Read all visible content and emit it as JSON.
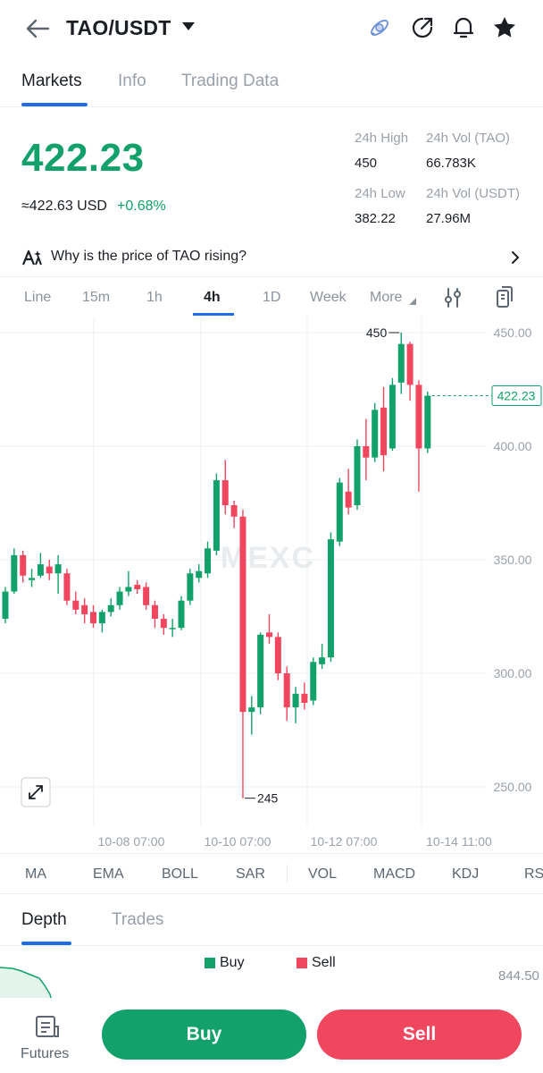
{
  "header": {
    "pair": "TAO/USDT",
    "icons": [
      "back-arrow-icon",
      "dropdown-caret-icon",
      "satellite-icon",
      "share-icon",
      "bell-icon",
      "star-icon"
    ]
  },
  "tabs": [
    {
      "label": "Markets",
      "active": true
    },
    {
      "label": "Info",
      "active": false
    },
    {
      "label": "Trading Data",
      "active": false
    }
  ],
  "ticker": {
    "price": "422.23",
    "usd_approx": "≈422.63  USD",
    "change": "+0.68%",
    "stats": {
      "high_label": "24h High",
      "high_value": "450",
      "vol_tao_label": "24h Vol (TAO)",
      "vol_tao_value": "66.783K",
      "low_label": "24h Low",
      "low_value": "382.22",
      "vol_usdt_label": "24h Vol  (USDT)",
      "vol_usdt_value": "27.96M"
    }
  },
  "why": {
    "text": "Why is the price of TAO rising?"
  },
  "intervals": [
    {
      "label": "Line",
      "active": false
    },
    {
      "label": "15m",
      "active": false
    },
    {
      "label": "1h",
      "active": false
    },
    {
      "label": "4h",
      "active": true
    },
    {
      "label": "1D",
      "active": false
    },
    {
      "label": "Week",
      "active": false
    },
    {
      "label": "More",
      "active": false
    }
  ],
  "chart_data": {
    "type": "candlestick",
    "interval": "4h",
    "watermark": "MEXC",
    "y_axis": {
      "min": 245,
      "max": 450,
      "ticks": [
        450.0,
        400.0,
        350.0,
        300.0,
        250.0
      ],
      "tick_labels": [
        "450.00",
        "400.00",
        "350.00",
        "300.00",
        "250.00"
      ]
    },
    "x_axis": {
      "tick_labels": [
        "10-08 07:00",
        "10-10 07:00",
        "10-12 07:00",
        "10-14 11:00"
      ]
    },
    "current_price_label": "422.23",
    "high_marker": {
      "value": 450,
      "label": "450"
    },
    "low_marker": {
      "value": 245,
      "label": "245"
    },
    "colors": {
      "up": "#12a16a",
      "down": "#f0465e",
      "grid": "#eef0f2"
    },
    "candles": [
      {
        "o": 324,
        "c": 336,
        "h": 338,
        "l": 322
      },
      {
        "o": 336,
        "c": 352,
        "h": 355,
        "l": 335
      },
      {
        "o": 352,
        "c": 343,
        "h": 354,
        "l": 340
      },
      {
        "o": 341,
        "c": 342,
        "h": 346,
        "l": 338
      },
      {
        "o": 343,
        "c": 348,
        "h": 353,
        "l": 342
      },
      {
        "o": 347,
        "c": 344,
        "h": 350,
        "l": 341
      },
      {
        "o": 344,
        "c": 348,
        "h": 352,
        "l": 335
      },
      {
        "o": 344,
        "c": 332,
        "h": 346,
        "l": 330
      },
      {
        "o": 332,
        "c": 328,
        "h": 336,
        "l": 326
      },
      {
        "o": 330,
        "c": 326,
        "h": 333,
        "l": 322
      },
      {
        "o": 327,
        "c": 322,
        "h": 330,
        "l": 320
      },
      {
        "o": 322,
        "c": 327,
        "h": 328,
        "l": 318
      },
      {
        "o": 327,
        "c": 330,
        "h": 333,
        "l": 325
      },
      {
        "o": 330,
        "c": 336,
        "h": 338,
        "l": 328
      },
      {
        "o": 336,
        "c": 338,
        "h": 345,
        "l": 334
      },
      {
        "o": 339,
        "c": 337,
        "h": 341,
        "l": 335
      },
      {
        "o": 338,
        "c": 330,
        "h": 340,
        "l": 328
      },
      {
        "o": 330,
        "c": 324,
        "h": 332,
        "l": 320
      },
      {
        "o": 324,
        "c": 320,
        "h": 326,
        "l": 317
      },
      {
        "o": 320,
        "c": 320,
        "h": 324,
        "l": 316
      },
      {
        "o": 320,
        "c": 332,
        "h": 334,
        "l": 319
      },
      {
        "o": 332,
        "c": 344,
        "h": 346,
        "l": 330
      },
      {
        "o": 342,
        "c": 345,
        "h": 348,
        "l": 340
      },
      {
        "o": 344,
        "c": 355,
        "h": 358,
        "l": 342
      },
      {
        "o": 354,
        "c": 385,
        "h": 388,
        "l": 352
      },
      {
        "o": 385,
        "c": 374,
        "h": 394,
        "l": 370
      },
      {
        "o": 374,
        "c": 369,
        "h": 376,
        "l": 364
      },
      {
        "o": 369,
        "c": 283,
        "h": 372,
        "l": 245
      },
      {
        "o": 283,
        "c": 285,
        "h": 290,
        "l": 273
      },
      {
        "o": 285,
        "c": 317,
        "h": 318,
        "l": 282
      },
      {
        "o": 318,
        "c": 316,
        "h": 326,
        "l": 313
      },
      {
        "o": 316,
        "c": 300,
        "h": 318,
        "l": 297
      },
      {
        "o": 300,
        "c": 285,
        "h": 303,
        "l": 279
      },
      {
        "o": 285,
        "c": 291,
        "h": 294,
        "l": 278
      },
      {
        "o": 291,
        "c": 287,
        "h": 296,
        "l": 284
      },
      {
        "o": 288,
        "c": 305,
        "h": 307,
        "l": 286
      },
      {
        "o": 304,
        "c": 307,
        "h": 313,
        "l": 302
      },
      {
        "o": 307,
        "c": 359,
        "h": 362,
        "l": 305
      },
      {
        "o": 358,
        "c": 384,
        "h": 386,
        "l": 356
      },
      {
        "o": 380,
        "c": 373,
        "h": 390,
        "l": 370
      },
      {
        "o": 374,
        "c": 400,
        "h": 403,
        "l": 372
      },
      {
        "o": 400,
        "c": 395,
        "h": 412,
        "l": 385
      },
      {
        "o": 395,
        "c": 416,
        "h": 419,
        "l": 393
      },
      {
        "o": 417,
        "c": 396,
        "h": 426,
        "l": 389
      },
      {
        "o": 399,
        "c": 427,
        "h": 430,
        "l": 398
      },
      {
        "o": 428,
        "c": 445,
        "h": 450,
        "l": 423
      },
      {
        "o": 445,
        "c": 427,
        "h": 446,
        "l": 420
      },
      {
        "o": 427,
        "c": 399,
        "h": 429,
        "l": 380
      },
      {
        "o": 399,
        "c": 422.23,
        "h": 424,
        "l": 397
      }
    ]
  },
  "indicators": [
    "MA",
    "EMA",
    "BOLL",
    "SAR",
    "VOL",
    "MACD",
    "KDJ",
    "RSI"
  ],
  "depth_tabs": [
    {
      "label": "Depth",
      "active": true
    },
    {
      "label": "Trades",
      "active": false
    }
  ],
  "depth": {
    "buy_label": "Buy",
    "sell_label": "Sell",
    "price_label": "844.50",
    "buy_color": "#12a16a",
    "sell_color": "#f0465e"
  },
  "bottom": {
    "futures_label": "Futures",
    "buy_button": "Buy",
    "sell_button": "Sell"
  }
}
